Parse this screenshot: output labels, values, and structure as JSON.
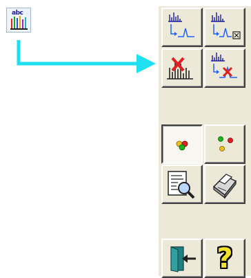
{
  "launch_button": {
    "label": "abc",
    "icon": "spectrum-bars-icon"
  },
  "toolbar": {
    "buttons": [
      {
        "name": "spectrum-to-peak-button",
        "icon": "spectrum-to-peak-icon"
      },
      {
        "name": "spectrum-to-peak-box-button",
        "icon": "spectrum-to-peak-box-icon"
      },
      {
        "name": "delete-spectrum-button",
        "icon": "spectrum-delete-icon"
      },
      {
        "name": "remove-peak-button",
        "icon": "peak-remove-icon"
      },
      {
        "name": "color-circles-button",
        "icon": "three-dots-icon",
        "pressed": true
      },
      {
        "name": "color-dots-button",
        "icon": "scattered-dots-icon"
      },
      {
        "name": "preview-button",
        "icon": "magnifier-document-icon"
      },
      {
        "name": "print-button",
        "icon": "printer-icon"
      },
      {
        "name": "exit-button",
        "icon": "door-exit-icon"
      },
      {
        "name": "help-button",
        "icon": "question-mark-icon",
        "label": "?"
      }
    ]
  },
  "colors": {
    "arrow": "#1ee0f0",
    "toolbar_bg": "#ece9d8",
    "spectrum_blue": "#1a1aa0",
    "red": "#e02020"
  }
}
